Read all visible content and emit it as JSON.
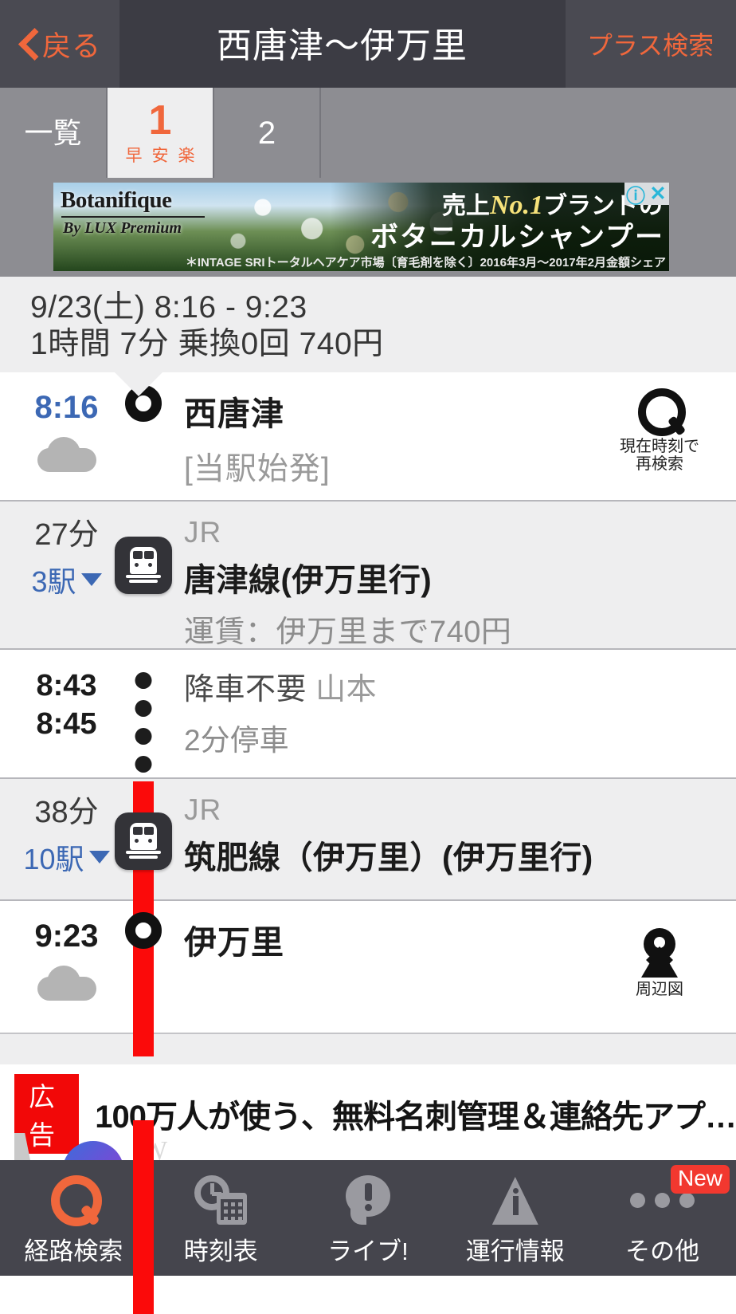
{
  "header": {
    "back_label": "戻る",
    "title": "西唐津～伊万里",
    "plus_search_label": "プラス検索"
  },
  "tabs": [
    {
      "label": "一覧",
      "sub": [],
      "active": false
    },
    {
      "label": "1",
      "sub": [
        "早",
        "安",
        "楽"
      ],
      "active": true
    },
    {
      "label": "2",
      "sub": [],
      "active": false
    }
  ],
  "ad_top": {
    "brand": "Botanifique",
    "brand_sub": "By LUX Premium",
    "line1_prefix": "売上",
    "line1_em": "No.1",
    "line1_suffix": "ブランドの",
    "line2": "ボタニカルシャンプー",
    "disclaimer": "＊INTAGE SRIトータルヘアケア市場〔育毛剤を除く〕2016年3月～2017年2月金額シェア",
    "info_icon": "info-icon",
    "close_icon": "close-icon"
  },
  "summary": {
    "line1": "9/23(土)  8:16 -  9:23",
    "line2": "1時間 7分 乗換0回 740円"
  },
  "route": {
    "departure": {
      "time": "8:16",
      "station": "西唐津",
      "note": "[当駅始発]",
      "weather_icon": "cloud-icon",
      "action_icon": "search-icon",
      "action_caption_line1": "現在時刻で",
      "action_caption_line2": "再検索"
    },
    "leg1": {
      "duration": "27分",
      "stops_label": "3駅",
      "operator": "JR",
      "line_name": "唐津線(伊万里行)",
      "fare_note": "運賃：伊万里まで740円",
      "icon": "train-icon"
    },
    "transfer": {
      "time_arrive": "8:43",
      "time_depart": "8:45",
      "note_prefix": "降車不要",
      "note_station": "山本",
      "note2": "2分停車"
    },
    "leg2": {
      "duration": "38分",
      "stops_label": "10駅",
      "operator": "JR",
      "line_name": "筑肥線（伊万里）(伊万里行)",
      "icon": "train-icon"
    },
    "arrival": {
      "time": "9:23",
      "station": "伊万里",
      "weather_icon": "cloud-icon",
      "action_icon": "map-pin-icon",
      "action_caption": "周辺図"
    }
  },
  "ad_bottom": {
    "badge": "広告",
    "text": "100万人が使う、無料名刺管理＆連絡先アプ…"
  },
  "bottom_nav": [
    {
      "label": "経路検索",
      "icon": "search-icon",
      "active": true,
      "badge": ""
    },
    {
      "label": "時刻表",
      "icon": "timetable-icon",
      "active": false,
      "badge": ""
    },
    {
      "label": "ライブ!",
      "icon": "live-speech-icon",
      "active": false,
      "badge": ""
    },
    {
      "label": "運行情報",
      "icon": "alert-triangle-icon",
      "active": false,
      "badge": ""
    },
    {
      "label": "その他",
      "icon": "more-dots-icon",
      "active": false,
      "badge": "New"
    }
  ],
  "colors": {
    "accent": "#f0673c",
    "rail_red": "#fb0a0a",
    "link_blue": "#3c68b4",
    "header_bg": "#4a4a52",
    "ad_red": "#f20808"
  }
}
